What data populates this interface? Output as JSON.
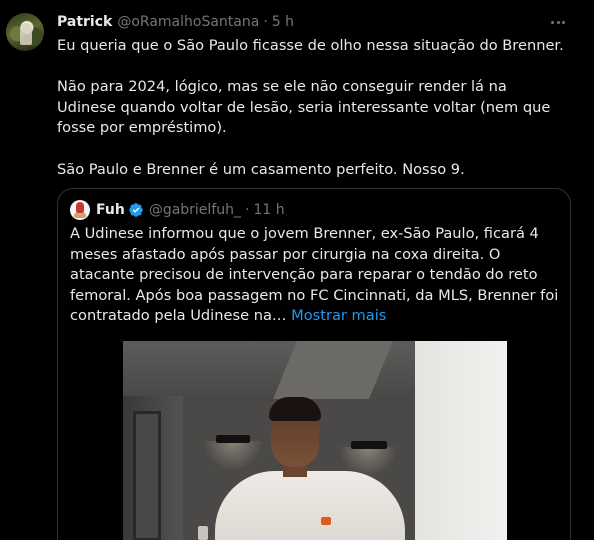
{
  "tweet": {
    "author_name": "Patrick",
    "author_handle": "@oRamalhoSantana",
    "separator": "·",
    "time": "5 h",
    "avatar_icon": "user-avatar",
    "more_icon": "more-dots-icon",
    "paragraphs": [
      "Eu queria que o São Paulo ficasse de olho nessa situação do Brenner.",
      "Não para 2024, lógico, mas se ele não conseguir render lá na Udinese quando voltar de lesão, seria interessante voltar (nem que fosse por empréstimo).",
      "São Paulo e Brenner é um casamento perfeito. Nosso 9."
    ]
  },
  "quoted": {
    "author_name": "Fuh",
    "author_handle": "@gabrielfuh_",
    "separator": "·",
    "time": "11 h",
    "verified_icon": "verified-badge-icon",
    "text": "A Udinese informou que o jovem Brenner, ex-São Paulo, ficará 4 meses afastado após passar por cirurgia na coxa direita. O atacante precisou de intervenção para reparar o tendão do reto femoral. Após boa passagem no FC Cincinnati, da MLS, Brenner foi contratado pela Udinese na…",
    "show_more": "Mostrar mais",
    "media_kind": "photo"
  },
  "colors": {
    "background": "#000000",
    "text": "#e7e9ea",
    "muted": "#71767b",
    "link": "#1d9bf0",
    "border": "#2f3336",
    "verified": "#1d9bf0"
  }
}
